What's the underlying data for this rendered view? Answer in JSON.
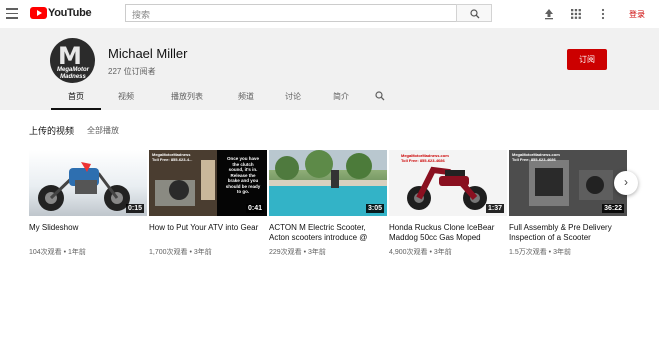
{
  "header": {
    "logo_text": "YouTube",
    "search_placeholder": "搜索",
    "login_label": "登录"
  },
  "channel": {
    "name": "Michael Miller",
    "subscribers": "227 位订阅者",
    "subscribe_label": "订阅",
    "avatar_letter": "M",
    "avatar_text": "MegaMotor Madness",
    "tabs": [
      "首页",
      "视频",
      "播放列表",
      "频道",
      "讨论",
      "简介"
    ]
  },
  "section": {
    "title": "上传的视频",
    "play_all": "全部播放"
  },
  "videos": [
    {
      "title": "My Slideshow",
      "meta": "104次观看 • 1年前",
      "duration": "0:15"
    },
    {
      "title": "How to Put Your ATV into Gear",
      "meta": "1,700次观看 • 3年前",
      "duration": "0:41",
      "thumb_lines": [
        "MegaMotorMadness",
        "Toll Free: 855-623-4..."
      ],
      "thumb_caption": "Once you have the clutch sound, it's in. Release the brake and you should be ready to go."
    },
    {
      "title": "ACTON M Electric Scooter, Acton scooters introduce @",
      "meta": "229次观看 • 3年前",
      "duration": "3:05"
    },
    {
      "title": "Honda Ruckus Clone IceBear Maddog 50cc Gas Moped",
      "meta": "4,900次观看 • 3年前",
      "duration": "1:37",
      "thumb_lines": [
        "MegaMotorMadness.com",
        "Toll Free: 855-623-4686"
      ]
    },
    {
      "title": "Full Assembly & Pre Delivery Inspection of a Scooter",
      "meta": "1.5万次观看 • 3年前",
      "duration": "36:22",
      "thumb_lines": [
        "MegaMotorMadness.com",
        "Toll Free: 855-623-4686"
      ]
    }
  ],
  "icons": {
    "menu": "hamburger-icon",
    "search": "search-icon",
    "upload": "upload-icon",
    "apps": "apps-grid-icon",
    "more": "more-vert-icon",
    "channel_search": "search-icon",
    "next": "chevron-right-icon"
  },
  "colors": {
    "brand_red": "#ff0000",
    "subscribe_red": "#cc0000",
    "header_bg": "#f1f1f1"
  }
}
